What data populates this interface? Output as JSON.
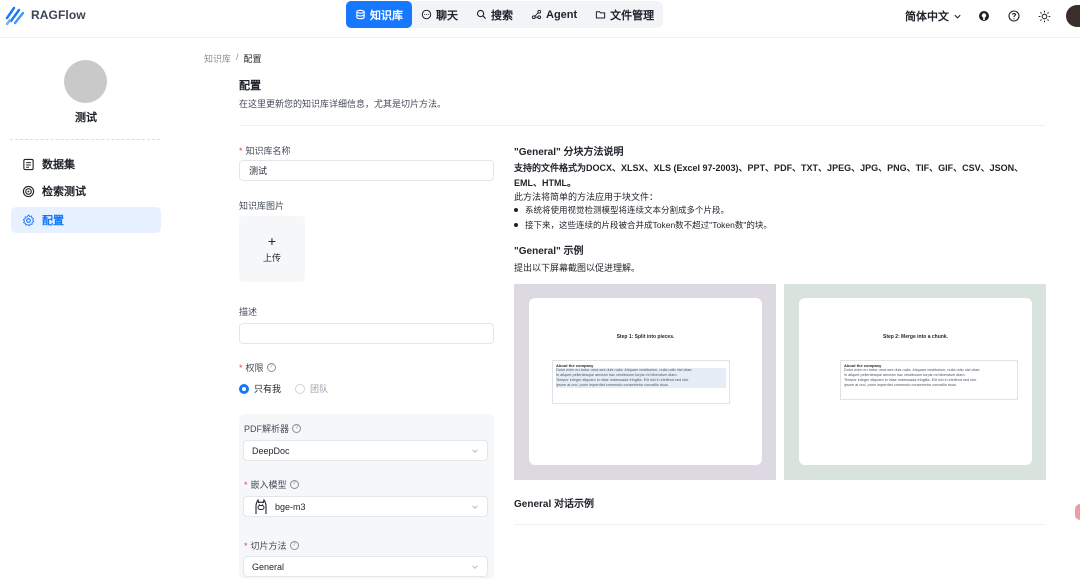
{
  "app": {
    "name": "RAGFlow"
  },
  "nav": {
    "items": [
      {
        "label": "知识库",
        "icon": "database-icon",
        "active": true
      },
      {
        "label": "聊天",
        "icon": "chat-icon",
        "active": false
      },
      {
        "label": "搜索",
        "icon": "search-icon",
        "active": false
      },
      {
        "label": "Agent",
        "icon": "agent-icon",
        "active": false
      },
      {
        "label": "文件管理",
        "icon": "folder-icon",
        "active": false
      }
    ]
  },
  "header_tools": {
    "language": "简体中文"
  },
  "sidebar": {
    "kb_name": "测试",
    "items": [
      {
        "label": "数据集",
        "icon": "dataset-icon"
      },
      {
        "label": "检索测试",
        "icon": "target-icon"
      },
      {
        "label": "配置",
        "icon": "gear-icon",
        "active": true
      }
    ]
  },
  "breadcrumb": {
    "parent": "知识库",
    "separator": "/",
    "current": "配置"
  },
  "page": {
    "title": "配置",
    "description": "在这里更新您的知识库详细信息，尤其是切片方法。"
  },
  "form": {
    "name_label": "知识库名称",
    "name_value": "测试",
    "image_label": "知识库图片",
    "upload_plus": "+",
    "upload_label": "上传",
    "description_label": "描述",
    "description_value": "",
    "permission_label": "权限",
    "permission_options": [
      "只有我",
      "团队"
    ],
    "pdf_parser_label": "PDF解析器",
    "pdf_parser_value": "DeepDoc",
    "embedding_label": "嵌入模型",
    "embedding_value": "bge-m3",
    "chunk_method_label": "切片方法",
    "chunk_method_value": "General"
  },
  "explanation": {
    "title": "\"General\" 分块方法说明",
    "formats_line1": "支持的文件格式为DOCX、XLSX、XLS (Excel 97-2003)、PPT、PDF、TXT、JPEG、JPG、PNG、TIF、GIF、CSV、JSON、",
    "formats_line2": "EML、HTML。",
    "method_line": "此方法将简单的方法应用于块文件：",
    "bullets": [
      "系统将使用视觉检测模型将连续文本分割成多个片段。",
      "接下来，这些连续的片段被合并成Token数不超过\"Token数\"的块。"
    ],
    "example_title": "\"General\" 示例",
    "example_desc": "提出以下屏幕截图以促进理解。",
    "step1_title": "Step 1: Split into pieces.",
    "step2_title": "Step 2: Merge into a chunk.",
    "snippet_heading": "About the company",
    "snippet_lines": [
      "Dolor enim eu tortor urna sed duis nulla. Aliquam vestibulum, nulla odio nisl vitae.",
      "In aliquet pellentesque aenean hac vestibulum turpis mi bibendum diam.",
      "Tempor integer aliquam in vitae malesuada fringilla. Elit nisi in eleifend sed nisi.",
      "ipsum at orci, proin imperdiet commodo consectetur convallis risus."
    ],
    "dialog_title": "General 对话示例"
  }
}
